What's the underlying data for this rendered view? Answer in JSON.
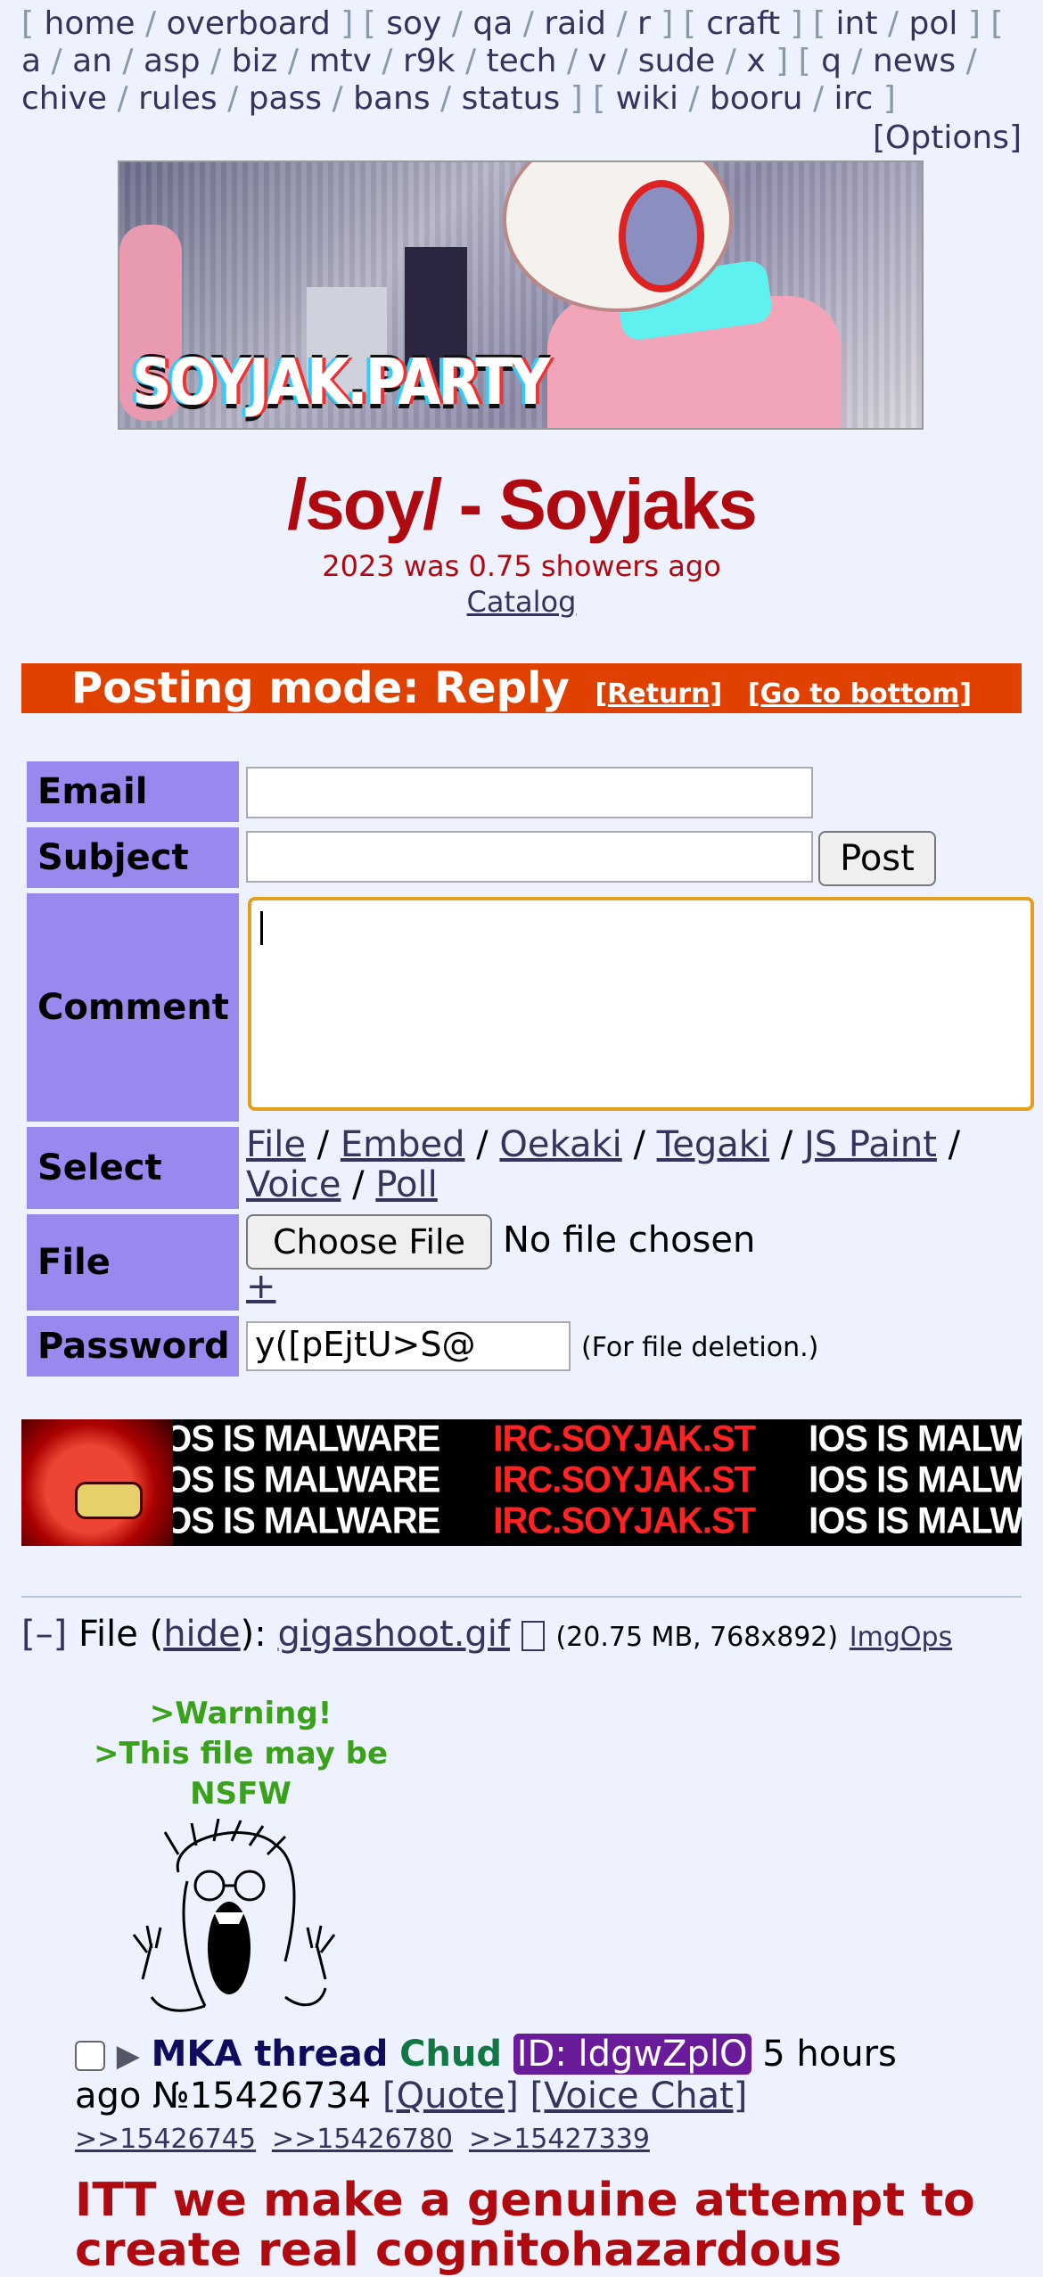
{
  "boardlist": {
    "groups": [
      [
        "home",
        "overboard"
      ],
      [
        "soy",
        "qa",
        "raid",
        "r"
      ],
      [
        "craft"
      ],
      [
        "int",
        "pol"
      ],
      [
        "a",
        "an",
        "asp",
        "biz",
        "mtv",
        "r9k",
        "tech",
        "v",
        "sude",
        "x"
      ],
      [
        "q",
        "news",
        "chive",
        "rules",
        "pass",
        "bans",
        "status"
      ],
      [
        "wiki",
        "booru",
        "irc"
      ]
    ],
    "options": "[Options]"
  },
  "banner": {
    "text": "SOYJAK.PARTY"
  },
  "board": {
    "title": "/soy/ - Soyjaks",
    "subtitle": "2023 was 0.75 showers ago",
    "catalog": "Catalog"
  },
  "posting": {
    "mode": "Posting mode: Reply",
    "return": "[Return]",
    "bottom": "[Go to bottom]"
  },
  "form": {
    "email_label": "Email",
    "subject_label": "Subject",
    "comment_label": "Comment",
    "select_label": "Select",
    "file_label": "File",
    "password_label": "Password",
    "post_button": "Post",
    "select_options": [
      "File",
      "Embed",
      "Oekaki",
      "Tegaki",
      "JS Paint",
      "Voice",
      "Poll"
    ],
    "choose_file": "Choose File",
    "no_file": "No file chosen",
    "plus": "+",
    "password_value": "y([pEjtU>S@",
    "password_note": "(For file deletion.)"
  },
  "ad": {
    "white_text": "IOS IS MALWARE",
    "red_text": "IRC.SOYJAK.ST"
  },
  "file": {
    "collapse": "[–]",
    "label": "File",
    "hide": "hide",
    "name": "gigashoot.gif",
    "icon": "download-icon",
    "meta": "(20.75 MB, 768x892)",
    "imgops": "ImgOps"
  },
  "warning": {
    "line1": ">Warning!",
    "line2": ">This file may be NSFW"
  },
  "post": {
    "subject": "MKA thread",
    "name": "Chud",
    "id": "ID: ldgwZplO",
    "time": "5 hours ago",
    "number": "№15426734",
    "quote": "[Quote]",
    "voice": "[Voice Chat]",
    "backlinks": [
      ">>15426745",
      ">>15426780",
      ">>15427339"
    ],
    "body": "ITT we make a genuine attempt to create real cognitohazardous"
  },
  "colors": {
    "background": "#eef2ff",
    "title_red": "#af0a0f",
    "posting_bar": "#e04000",
    "label_purple": "#9988ee",
    "greentext": "#3aa21a",
    "id_badge": "#6a1b9a"
  }
}
